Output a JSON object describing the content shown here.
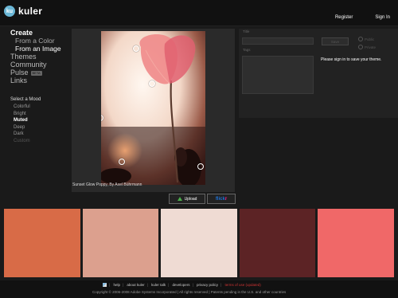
{
  "header": {
    "logo_badge": "ku",
    "logo_text": "kuler",
    "register": "Register",
    "signin": "Sign In"
  },
  "nav": {
    "create": "Create",
    "from_color": "From a Color",
    "from_image": "From an Image",
    "themes": "Themes",
    "community": "Community",
    "pulse": "Pulse",
    "pulse_badge": "BETA",
    "links": "Links"
  },
  "mood": {
    "heading": "Select a Mood",
    "items": [
      "Colorful",
      "Bright",
      "Muted",
      "Deep",
      "Dark",
      "Custom"
    ],
    "selected": "Muted"
  },
  "image": {
    "caption": "Sunset Glow Poppy, By Axel Bührmann"
  },
  "buttons": {
    "upload": "Upload",
    "flickr_a": "flick",
    "flickr_b": "r"
  },
  "form": {
    "title_label": "Title",
    "tags_label": "Tags",
    "save": "Save",
    "public": "Public",
    "private": "Private",
    "signin_message": "Please sign in to save your theme."
  },
  "swatches": [
    "#d86b47",
    "#dca08e",
    "#efdbd3",
    "#5c2325",
    "#f06868"
  ],
  "footer": {
    "links": [
      "help",
      "about kuler",
      "kuler talk",
      "developers",
      "privacy policy",
      "terms of use (updated)"
    ],
    "copyright": "Copyright © 2006-2008 Adobe Systems Incorporated | All rights reserved | Patents pending in the U.S. and other countries"
  }
}
